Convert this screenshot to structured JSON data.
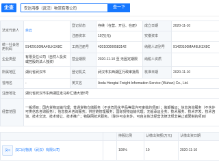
{
  "header": {
    "logo_text": "企查",
    "search_value": "安达鸿泰（武汉）物流有限公司",
    "search_button": "查一下"
  },
  "info": {
    "legal_rep": {
      "label": "法定代表人",
      "value": "余云"
    },
    "status": {
      "label": "登记状态",
      "value": "存续（在营、开业、在册）"
    },
    "founded": {
      "label": "成立日期",
      "value": "2020-11-10"
    },
    "reg_capital": {
      "label": "注册资本",
      "value": "10万(元)"
    },
    "paid_capital": {
      "label": "实缴资本",
      "value": ""
    },
    "credit_code": {
      "label": "统一社会信用代码",
      "value": "91420100MA49LK3X8C"
    },
    "reg_no": {
      "label": "工商注册号",
      "value": "420100000583142"
    },
    "tax_id": {
      "label": "纳税人识别号",
      "value": "91420100MA49LK3X8C"
    },
    "company_type": {
      "label": "企业类型",
      "value": "有限责任公司（自然人投资或控股的法人独资）"
    },
    "term": {
      "label": "营业期限",
      "value": "2020-11-10 至 无固定期限"
    },
    "tax_qual": {
      "label": "纳税人资质",
      "value": ""
    },
    "region": {
      "label": "所属地区",
      "value": "湖北省武汉市"
    },
    "authority": {
      "label": "登记机关",
      "value": "武汉市东西湖区行政审批局"
    },
    "approved": {
      "label": "核准日期",
      "value": "2020-11-10"
    },
    "former_name": {
      "label": "曾用名",
      "value": "-"
    },
    "english_name": {
      "label": "英文名",
      "value": "Anda Hongtai Freight Information Service (Wuhan) Co., Ltd."
    },
    "address": {
      "label": "注册地址",
      "value": "湖北省武汉市东西湖区走马岭汇通大道5号"
    },
    "scope": {
      "label": "经营范围",
      "value": "一般项目：国内货物运输代理；普通货物仓储服务（不含危险化学品等需许可审批的项目）；装卸搬运；信息咨询服务（不含许可类信息咨询服务）；信息技术咨询服务；供应链管理服务；国际货物运输代理；无船承运业务；技术服务、技术开发、技术咨询、技术交流、技术转让、技术推广；物联网技术服务。（除许可业务外，可自主依法经营法律法规非禁止或限制的项目）"
    }
  },
  "shareholders": {
    "headers": [
      "持股比例",
      "认缴出资额(万元)",
      "认缴出资日期"
    ],
    "rows": [
      {
        "logo_text": "汉口",
        "name": "汉口北物流（武汉）有限公司",
        "ratio": "100%",
        "amount": "10",
        "date": "2020-11-10"
      }
    ]
  },
  "colors": {
    "brand": "#1677ff",
    "label_bg": "#f5f8fb",
    "border": "#e6eaf0"
  }
}
